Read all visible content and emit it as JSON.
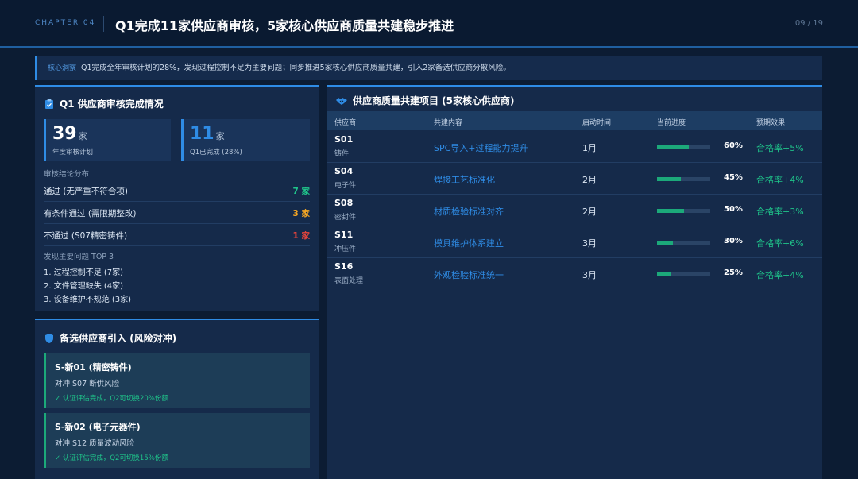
{
  "header": {
    "chapter": "CHAPTER 04",
    "title": "Q1完成11家供应商审核，5家核心供应商质量共建稳步推进",
    "page": "09 / 19"
  },
  "insight": {
    "tag": "核心洞察",
    "text": "Q1完成全年审核计划的28%，发现过程控制不足为主要问题；同步推进5家核心供应商质量共建，引入2家备选供应商分散风险。"
  },
  "audit": {
    "title": "Q1 供应商审核完成情况",
    "plan": {
      "value": "39",
      "unit": "家",
      "label": "年度审核计划"
    },
    "done": {
      "value": "11",
      "unit": "家",
      "label": "Q1已完成 (28%)"
    },
    "distribution_label": "审核结论分布",
    "results": [
      {
        "label": "通过 (无严重不符合项)",
        "count": "7 家",
        "color": "#1fc48a"
      },
      {
        "label": "有条件通过 (需限期整改)",
        "count": "3 家",
        "color": "#f5a623"
      },
      {
        "label": "不通过 (S07精密铸件)",
        "count": "1 家",
        "color": "#e8453c"
      }
    ],
    "issues_label": "发现主要问题 TOP 3",
    "issues": [
      "1. 过程控制不足 (7家)",
      "2. 文件管理缺失 (4家)",
      "3. 设备维护不规范 (3家)"
    ]
  },
  "backup": {
    "title": "备选供应商引入 (风险对冲)",
    "cards": [
      {
        "name": "S-新01 (精密铸件)",
        "desc": "对冲 S07 断供风险",
        "status": "✓ 认证评估完成，Q2可切换20%份额"
      },
      {
        "name": "S-新02 (电子元器件)",
        "desc": "对冲 S12 质量波动风险",
        "status": "✓ 认证评估完成，Q2可切换15%份额"
      }
    ]
  },
  "quality": {
    "title": "供应商质量共建项目 (5家核心供应商)",
    "columns": [
      "供应商",
      "共建内容",
      "启动时间",
      "当前进度",
      "预期效果"
    ],
    "rows": [
      {
        "code": "S01",
        "type": "铸件",
        "content": "SPC导入+过程能力提升",
        "start": "1月",
        "progress": 0.6,
        "pct": "60%",
        "effect": "合格率+5%"
      },
      {
        "code": "S04",
        "type": "电子件",
        "content": "焊接工艺标准化",
        "start": "2月",
        "progress": 0.45,
        "pct": "45%",
        "effect": "合格率+4%"
      },
      {
        "code": "S08",
        "type": "密封件",
        "content": "材质检验标准对齐",
        "start": "2月",
        "progress": 0.5,
        "pct": "50%",
        "effect": "合格率+3%"
      },
      {
        "code": "S11",
        "type": "冲压件",
        "content": "模具维护体系建立",
        "start": "3月",
        "progress": 0.3,
        "pct": "30%",
        "effect": "合格率+6%"
      },
      {
        "code": "S16",
        "type": "表面处理",
        "content": "外观检验标准统一",
        "start": "3月",
        "progress": 0.25,
        "pct": "25%",
        "effect": "合格率+4%"
      }
    ]
  },
  "colors": {
    "accent": "#2f8ce5",
    "good": "#1fc48a",
    "warn": "#f5a623",
    "bad": "#e8453c"
  }
}
